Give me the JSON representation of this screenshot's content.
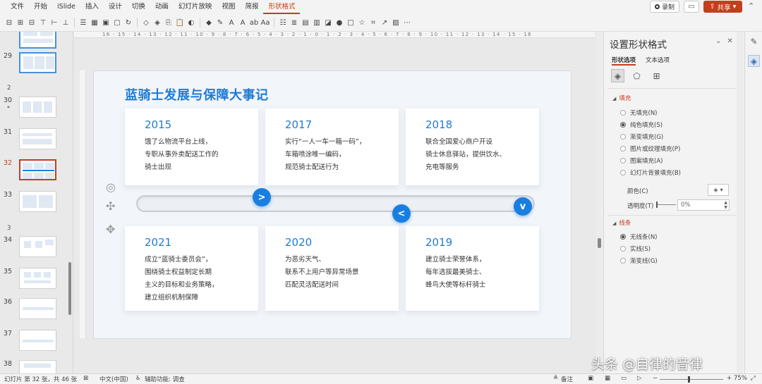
{
  "menu": {
    "items": [
      "文件",
      "开始",
      "iSlide",
      "插入",
      "设计",
      "切换",
      "动画",
      "幻灯片放映",
      "视图",
      "简报",
      "形状格式"
    ],
    "active": "形状格式"
  },
  "topbar": {
    "record_label": "录制",
    "share_label": "共享"
  },
  "thumbnails": {
    "slide_29": "29",
    "section_2": "2",
    "slide_30": "30",
    "slide_30_star": "*",
    "slide_31": "31",
    "slide_32": "32",
    "slide_33": "33",
    "section_3": "3",
    "slide_34": "34",
    "slide_35": "35",
    "slide_36": "36",
    "slide_37": "37",
    "slide_38": "38"
  },
  "ruler_text": "16 · 15 · 14 · 13 · 12 · 11 · 10 · 9 · 8 · 7 · 6 · 5 · 4 · 3 · 2 · 1 · 0 · 1 · 2 · 3 · 4 · 5 · 6 · 7 · 8 · 9 · 10 · 11 · 12 · 13 · 14 · 15 · 16",
  "slide": {
    "title": "蓝骑士发展与保障大事记",
    "cards": [
      {
        "year": "2015",
        "lines": [
          "饿了么物流平台上线，",
          "专职从事外卖配送工作的",
          "骑士出现"
        ]
      },
      {
        "year": "2017",
        "lines": [
          "实行“一人一车一箱一码”，",
          "车箱喷涂唯一编码，",
          "规范骑士配送行为"
        ]
      },
      {
        "year": "2018",
        "lines": [
          "联合全国爱心商户开设",
          "骑士休息驿站，提供饮水、",
          "充电等服务"
        ]
      },
      {
        "year": "2021",
        "lines": [
          "成立“蓝骑士委员会”，",
          "围绕骑士权益制定长期",
          "主义的目标和业务策略，",
          "建立组织机制保障"
        ]
      },
      {
        "year": "2020",
        "lines": [
          "为恶劣天气、",
          "联系不上用户等异常场景",
          "匹配灵活配送时间"
        ]
      },
      {
        "year": "2019",
        "lines": [
          "建立骑士荣誉体系，",
          "每年选拔最美骑士、",
          "蜂鸟大使等标杆骑士"
        ]
      }
    ],
    "nodes": [
      ">",
      "<",
      "v"
    ]
  },
  "format_pane": {
    "title": "设置形状格式",
    "tab_shape": "形状选项",
    "tab_text": "文本选项",
    "fill_header": "填充",
    "fill_options": [
      "无填充(N)",
      "纯色填充(S)",
      "渐变填充(G)",
      "图片或纹理填充(P)",
      "图案填充(A)",
      "幻灯片背景填充(B)"
    ],
    "fill_selected": "纯色填充(S)",
    "color_label": "颜色(C)",
    "transparency_label": "透明度(T)",
    "transparency_value": "0%",
    "line_header": "线条",
    "line_options": [
      "无线条(N)",
      "实线(S)",
      "渐变线(G)"
    ],
    "line_selected": "无线条(N)"
  },
  "status": {
    "slide_info": "幻灯片 第 32 张，共 46 张",
    "language": "中文(中国)",
    "accessibility": "辅助功能: 调查",
    "notes": "备注",
    "zoom": "75%"
  },
  "watermark": "头条 @自律的音律",
  "colors": {
    "accent": "#c43e1c",
    "brand_blue": "#1f7bd6",
    "node_blue": "#1a7ee0"
  }
}
